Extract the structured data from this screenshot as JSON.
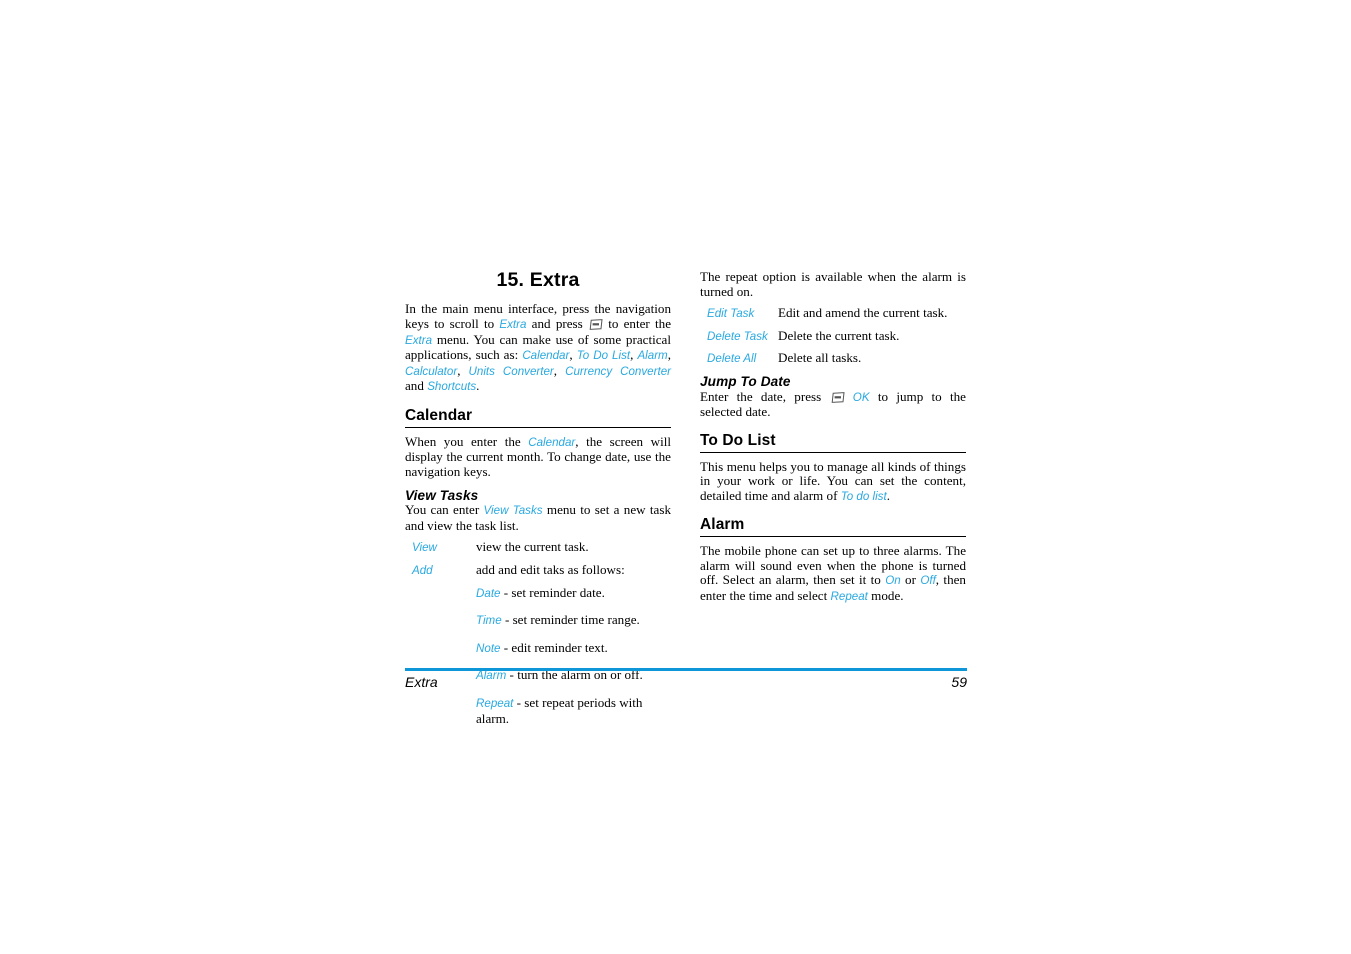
{
  "document": {
    "chapter_title": "15. Extra",
    "accent_color": "#29a9e0",
    "rule_color": "#0d97d8"
  },
  "left_column": {
    "intro": {
      "p1_a": "In the main menu interface, press the navigation keys to scroll to ",
      "p1_ui1": "Extra",
      "p1_b": " and press ",
      "p1_icon": "softkey-icon",
      "p1_c": " to enter the ",
      "p1_ui2": "Extra",
      "p1_d": " menu. You can make use of some practical applications, such as: ",
      "p1_ui3": "Calendar",
      "p1_sep1": ", ",
      "p1_ui4": "To Do List",
      "p1_sep2": ", ",
      "p1_ui5": "Alarm",
      "p1_sep3": ", ",
      "p1_ui6": "Calculator",
      "p1_sep4": ", ",
      "p1_ui7": "Units Converter",
      "p1_sep5": ", ",
      "p1_ui8": "Currency Converter",
      "p1_sep6": " and ",
      "p1_ui9": "Shortcuts",
      "p1_end": "."
    },
    "calendar": {
      "heading": "Calendar",
      "p_a": "When you enter the ",
      "p_ui": "Calendar",
      "p_b": ", the screen will display the current month. To change date, use the navigation keys."
    },
    "view_tasks": {
      "heading": "View Tasks",
      "p_a": "You can enter ",
      "p_ui": "View Tasks",
      "p_b": " menu to set a new task and view the task list.",
      "items": [
        {
          "term": "View",
          "desc": "view the current task."
        },
        {
          "term": "Add",
          "desc": "add and edit taks as follows:"
        }
      ],
      "subitems": [
        {
          "ui": "Date",
          "desc": " - set reminder date."
        },
        {
          "ui": "Time",
          "desc": " -  set reminder time range."
        },
        {
          "ui": "Note",
          "desc": " -  edit reminder text."
        },
        {
          "ui": "Alarm",
          "desc": " - turn the alarm on or off."
        },
        {
          "ui": "Repeat",
          "desc": " - set repeat periods with alarm."
        }
      ]
    }
  },
  "right_column": {
    "repeat_note": "The repeat option is available when the alarm is turned on.",
    "task_items": [
      {
        "term": "Edit Task",
        "desc": "Edit and amend the current task."
      },
      {
        "term": "Delete Task",
        "desc": "Delete the current task."
      },
      {
        "term": "Delete All",
        "desc": "Delete all tasks."
      }
    ],
    "jump_to_date": {
      "heading": "Jump To Date",
      "p_a": "Enter the date, press ",
      "p_icon": "softkey-icon",
      "p_ui": "OK",
      "p_b": " to jump to the selected date."
    },
    "to_do_list": {
      "heading": "To Do List",
      "p_a": "This menu helps you to manage all kinds of things in your work or life. You can set the content, detailed time and alarm of ",
      "p_ui": "To do list",
      "p_b": "."
    },
    "alarm": {
      "heading": "Alarm",
      "p_a": "The mobile phone can set up to three alarms. The alarm will sound even when the phone is turned off. Select an alarm, then set it to ",
      "p_ui1": "On",
      "p_b": " or ",
      "p_ui2": "Off",
      "p_c": ", then enter the time and select ",
      "p_ui3": "Repeat",
      "p_d": " mode."
    }
  },
  "footer": {
    "label": "Extra",
    "page_number": "59"
  }
}
